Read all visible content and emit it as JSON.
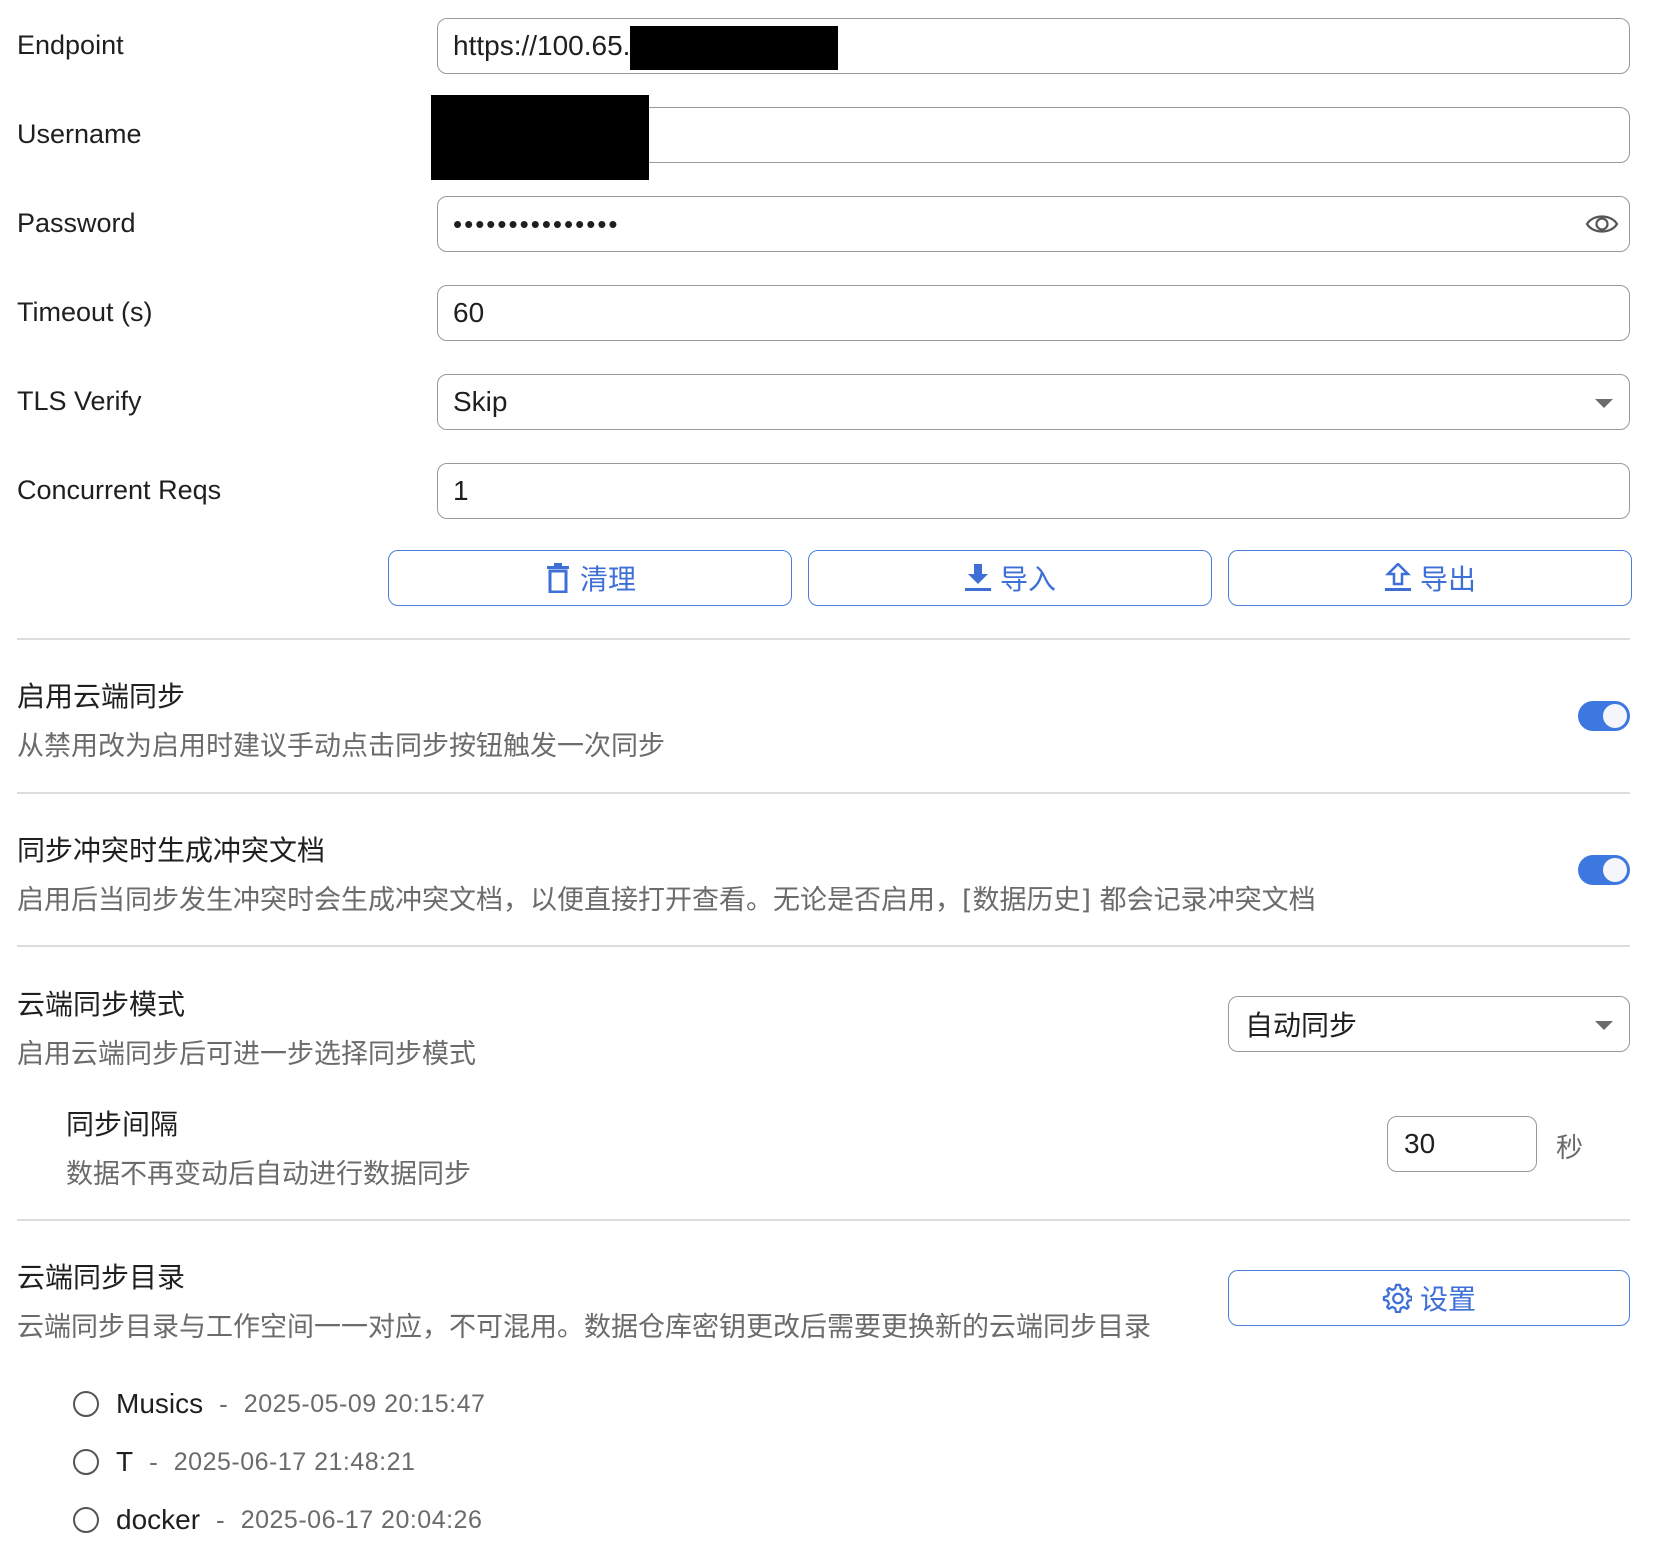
{
  "form": {
    "endpoint": {
      "label": "Endpoint",
      "value": "https://100.65."
    },
    "username": {
      "label": "Username",
      "value": ""
    },
    "password": {
      "label": "Password",
      "value": "•••••••••••••••"
    },
    "timeout": {
      "label": "Timeout (s)",
      "value": "60"
    },
    "tls_verify": {
      "label": "TLS Verify",
      "value": "Skip"
    },
    "concurrent": {
      "label": "Concurrent Reqs",
      "value": "1"
    }
  },
  "actions": {
    "clean_label": "清理",
    "import_label": "导入",
    "export_label": "导出"
  },
  "sections": {
    "cloud_sync": {
      "title": "启用云端同步",
      "desc": "从禁用改为启用时建议手动点击同步按钮触发一次同步",
      "enabled": true
    },
    "conflict_doc": {
      "title": "同步冲突时生成冲突文档",
      "desc": "启用后当同步发生冲突时会生成冲突文档，以便直接打开查看。无论是否启用，[数据历史] 都会记录冲突文档",
      "enabled": true
    },
    "sync_mode": {
      "title": "云端同步模式",
      "desc": "启用云端同步后可进一步选择同步模式",
      "value": "自动同步"
    },
    "sync_interval": {
      "title": "同步间隔",
      "desc": "数据不再变动后自动进行数据同步",
      "value": "30",
      "unit": "秒"
    },
    "sync_dir": {
      "title": "云端同步目录",
      "desc": "云端同步目录与工作空间一一对应，不可混用。数据仓库密钥更改后需要更换新的云端同步目录",
      "button_label": "设置"
    }
  },
  "directories": [
    {
      "name": "Musics",
      "sep": "-",
      "time": "2025-05-09 20:15:47"
    },
    {
      "name": "T",
      "sep": "-",
      "time": "2025-06-17 21:48:21"
    },
    {
      "name": "docker",
      "sep": "-",
      "time": "2025-06-17 20:04:26"
    }
  ],
  "colors": {
    "accent": "#3d77e0",
    "border": "#9a9a9a",
    "muted_text": "#6b6b6b"
  },
  "icons": {
    "password_toggle": "eye-icon",
    "clean": "trash-icon",
    "import": "download-icon",
    "export": "upload-icon",
    "settings": "gear-icon",
    "select": "caret-down-icon"
  }
}
